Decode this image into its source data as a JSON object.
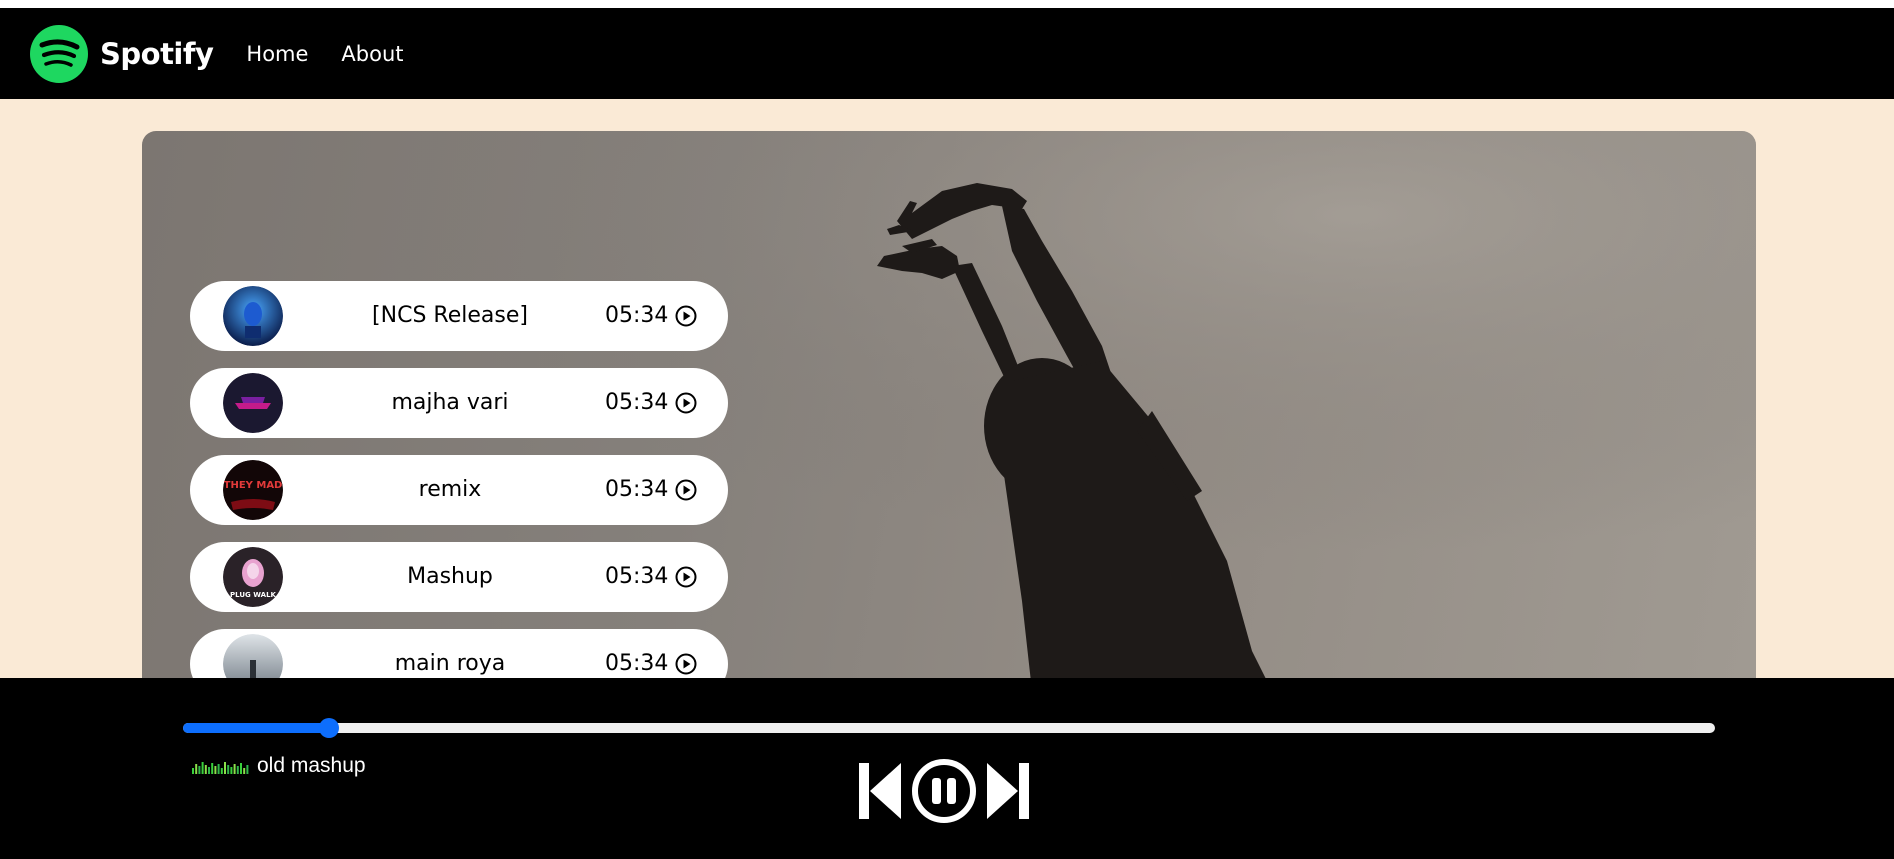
{
  "nav": {
    "brand": "Spotify",
    "links": [
      "Home",
      "About"
    ]
  },
  "songs": [
    {
      "name": "[NCS Release]",
      "duration": "05:34"
    },
    {
      "name": "majha vari",
      "duration": "05:34"
    },
    {
      "name": "remix",
      "duration": "05:34"
    },
    {
      "name": "Mashup",
      "duration": "05:34"
    },
    {
      "name": "main roya",
      "duration": "05:34"
    }
  ],
  "cover_texts": {
    "remix_cover": "THEY MAD",
    "mashup_cover": "PLUG WALK"
  },
  "player": {
    "now_playing": "old mashup",
    "progress": 0.095,
    "state": "playing",
    "controls": [
      "previous",
      "pause",
      "next"
    ]
  },
  "colors": {
    "brand_green": "#1ed760",
    "progress_blue": "#0d6efd",
    "page_bg": "#faead6"
  },
  "icons": [
    "spotify-logo-icon",
    "play-circle-icon",
    "equalizer-icon",
    "previous-icon",
    "pause-circle-icon",
    "next-icon"
  ]
}
